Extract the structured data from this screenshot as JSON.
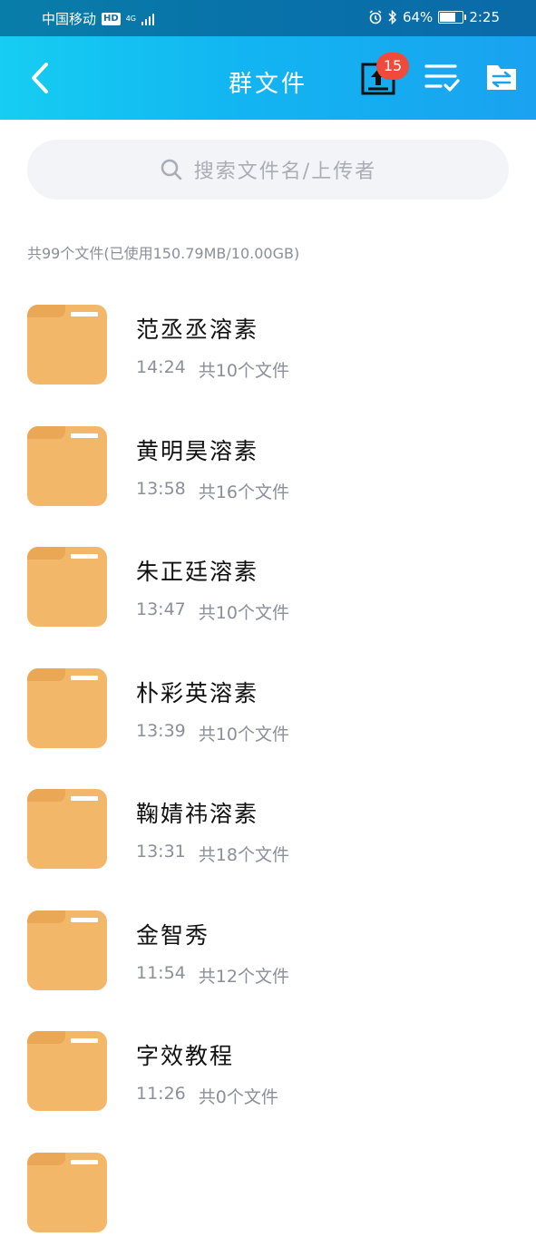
{
  "status_bar": {
    "carrier": "中国移动",
    "hd": "HD",
    "network": "4G",
    "battery": "64%",
    "time": "2:25"
  },
  "header": {
    "title": "群文件",
    "upload_badge": "15"
  },
  "search": {
    "placeholder": "搜索文件名/上传者"
  },
  "summary": "共99个文件(已使用150.79MB/10.00GB)",
  "files": [
    {
      "name": "范丞丞溶素",
      "time": "14:24",
      "count": "共10个文件"
    },
    {
      "name": "黄明昊溶素",
      "time": "13:58",
      "count": "共16个文件"
    },
    {
      "name": "朱正廷溶素",
      "time": "13:47",
      "count": "共10个文件"
    },
    {
      "name": "朴彩英溶素",
      "time": "13:39",
      "count": "共10个文件"
    },
    {
      "name": "鞠婧祎溶素",
      "time": "13:31",
      "count": "共18个文件"
    },
    {
      "name": "金智秀",
      "time": "11:54",
      "count": "共12个文件"
    },
    {
      "name": "字效教程",
      "time": "11:26",
      "count": "共0个文件"
    }
  ],
  "colors": {
    "header_start": "#16cdf2",
    "header_end": "#1aa2f0",
    "folder": "#f3b76a",
    "badge": "#ef4a3a",
    "secondary_text": "#8a8f99"
  }
}
